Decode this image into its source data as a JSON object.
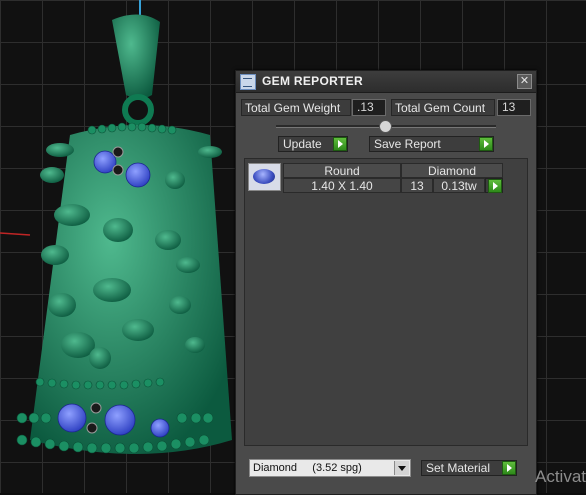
{
  "window": {
    "title": "GEM REPORTER",
    "close_symbol": "✕",
    "title_icon": "gem-reporter-icon"
  },
  "totals": {
    "weight_label": "Total Gem Weight",
    "weight_value": ".13",
    "count_label": "Total Gem Count",
    "count_value": "13"
  },
  "actions": {
    "update_label": "Update",
    "save_report_label": "Save Report"
  },
  "gem_table": {
    "headers": [
      "Round",
      "Diamond"
    ],
    "rows": [
      {
        "size": "1.40 X 1.40",
        "count": "13",
        "weight": "0.13tw"
      }
    ]
  },
  "material": {
    "selected": "Diamond     (3.52 spg)",
    "set_label": "Set Material"
  },
  "watermark": "Activate"
}
